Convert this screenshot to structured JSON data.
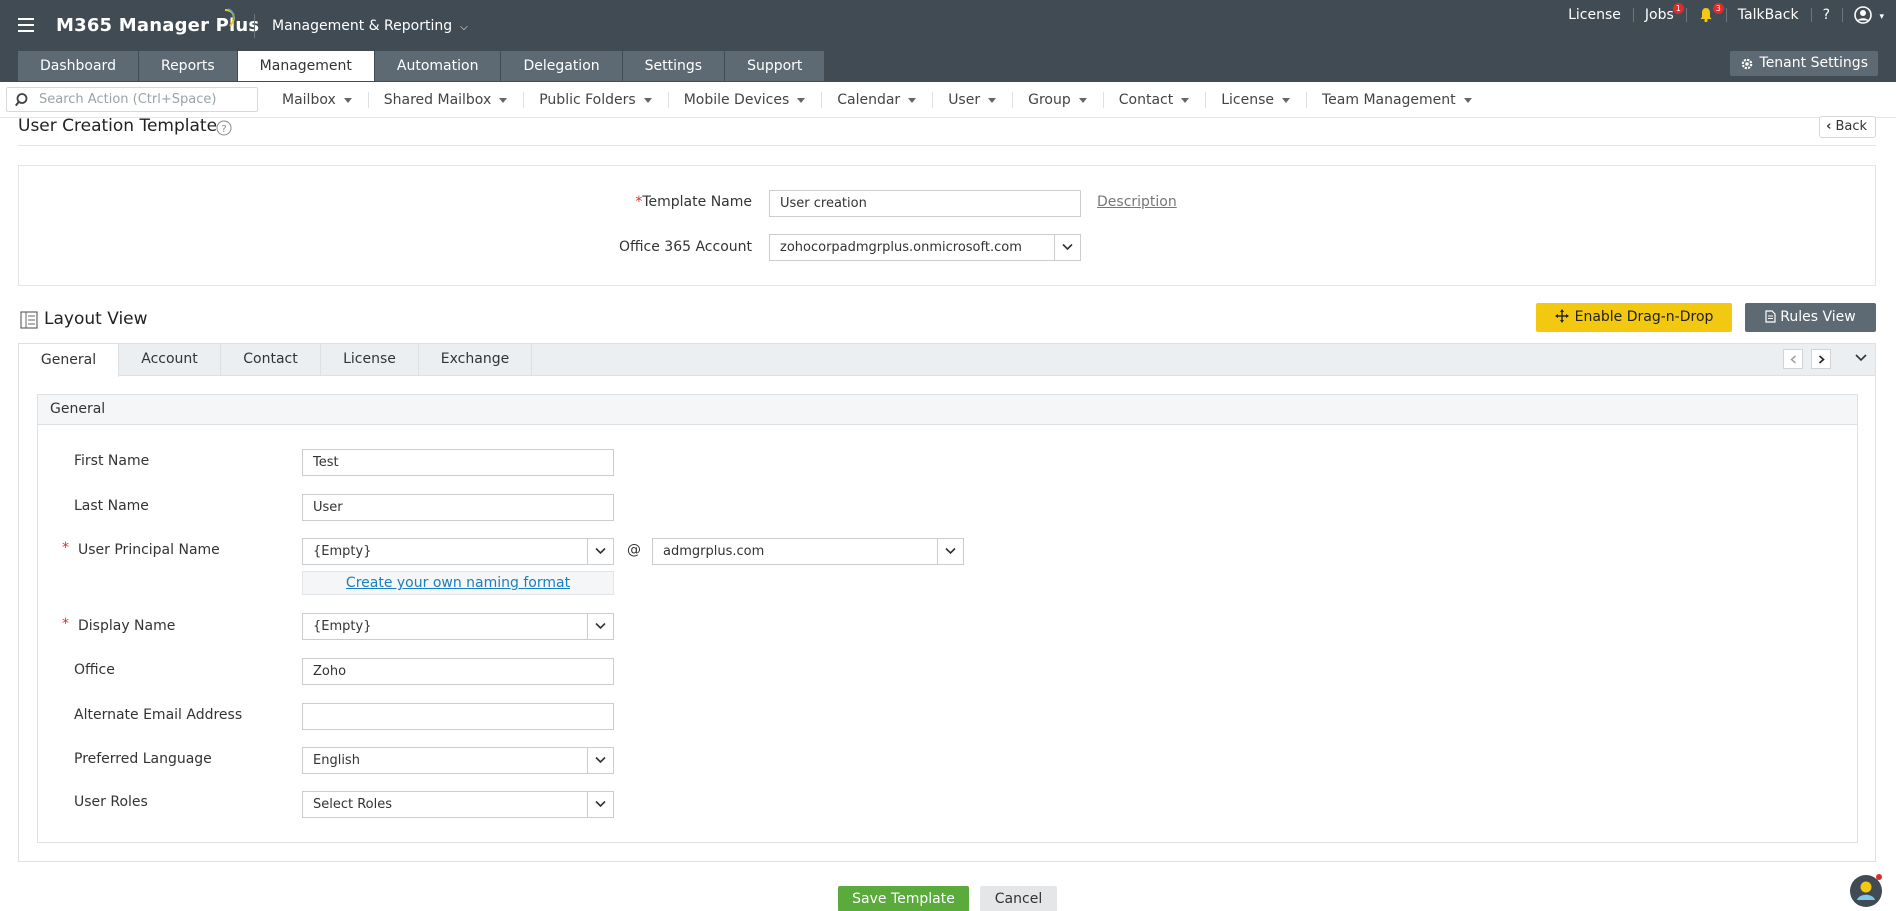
{
  "header": {
    "app_name": "M365 Manager Plus",
    "product_selector": "Management & Reporting",
    "links": {
      "license": "License",
      "jobs": "Jobs",
      "jobs_badge": "1",
      "notifications_badge": "3",
      "talkback": "TalkBack",
      "help": "?"
    }
  },
  "main_tabs": [
    {
      "label": "Dashboard"
    },
    {
      "label": "Reports"
    },
    {
      "label": "Management"
    },
    {
      "label": "Automation"
    },
    {
      "label": "Delegation"
    },
    {
      "label": "Settings"
    },
    {
      "label": "Support"
    }
  ],
  "active_main_tab": "Management",
  "tenant_settings": "Tenant Settings",
  "subnav": {
    "search_placeholder": "Search Action (Ctrl+Space)",
    "items": [
      {
        "label": "Mailbox"
      },
      {
        "label": "Shared Mailbox"
      },
      {
        "label": "Public Folders"
      },
      {
        "label": "Mobile Devices"
      },
      {
        "label": "Calendar"
      },
      {
        "label": "User"
      },
      {
        "label": "Group"
      },
      {
        "label": "Contact"
      },
      {
        "label": "License"
      },
      {
        "label": "Team Management"
      }
    ]
  },
  "page": {
    "title": "User Creation Template",
    "back": "Back"
  },
  "template": {
    "name_label": "Template Name",
    "name_value": "User creation",
    "description_link": "Description",
    "account_label": "Office 365 Account",
    "account_value": "zohocorpadmgrplus.onmicrosoft.com"
  },
  "layout": {
    "title": "Layout View",
    "enable_dnd": "Enable Drag-n-Drop",
    "rules_view": "Rules View",
    "tabs": [
      {
        "label": "General"
      },
      {
        "label": "Account"
      },
      {
        "label": "Contact"
      },
      {
        "label": "License"
      },
      {
        "label": "Exchange"
      }
    ],
    "active_tab": "General"
  },
  "general": {
    "section_title": "General",
    "first_name_label": "First Name",
    "first_name_value": "Test",
    "last_name_label": "Last Name",
    "last_name_value": "User",
    "upn_label": "User Principal Name",
    "upn_value": "{Empty}",
    "at": "@",
    "domain_value": "admgrplus.com",
    "naming_link": "Create your own naming format",
    "display_name_label": "Display Name",
    "display_name_value": "{Empty}",
    "office_label": "Office",
    "office_value": "Zoho",
    "alt_email_label": "Alternate Email Address",
    "alt_email_value": "",
    "language_label": "Preferred Language",
    "language_value": "English",
    "roles_label": "User Roles",
    "roles_value": "Select Roles"
  },
  "footer": {
    "save": "Save Template",
    "cancel": "Cancel"
  }
}
